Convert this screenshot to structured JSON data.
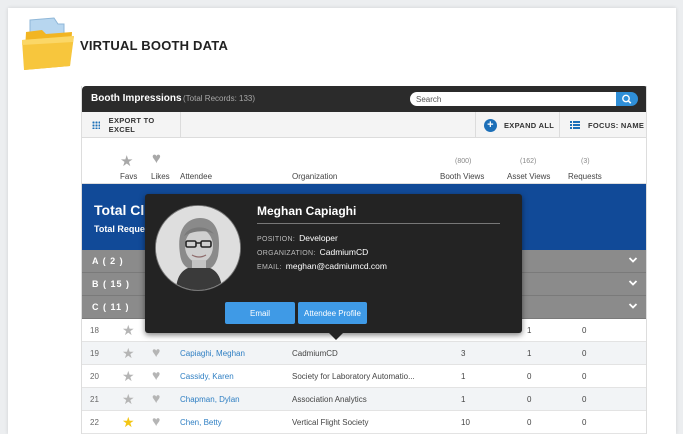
{
  "page": {
    "title": "VIRTUAL BOOTH DATA"
  },
  "panel": {
    "title": "Booth Impressions",
    "records": "(Total Records: 133)",
    "search_placeholder": "Search"
  },
  "toolbar": {
    "export_label": "EXPORT TO EXCEL",
    "expand_label": "EXPAND ALL",
    "focus_label": "FOCUS: NAME"
  },
  "columns": {
    "favs": "Favs",
    "likes": "Likes",
    "attendee": "Attendee",
    "organization": "Organization",
    "booth_views": "Booth Views",
    "booth_views_total": "(800)",
    "asset_views": "Asset Views",
    "asset_views_total": "(162)",
    "requests": "Requests",
    "requests_total": "(3)"
  },
  "totals": {
    "heading": "Total Cli",
    "sub": "Total Reque"
  },
  "groups": [
    {
      "label": "A ( 2 )"
    },
    {
      "label": "B ( 15 )"
    },
    {
      "label": "C ( 11 )"
    }
  ],
  "rows": [
    {
      "num": "18",
      "attendee": "",
      "org": "",
      "booth": "",
      "asset": "1",
      "requests": "0",
      "fav": false
    },
    {
      "num": "19",
      "attendee": "Capiaghi, Meghan",
      "org": "CadmiumCD",
      "booth": "3",
      "asset": "1",
      "requests": "0",
      "fav": false
    },
    {
      "num": "20",
      "attendee": "Cassidy, Karen",
      "org": "Society for Laboratory Automatio...",
      "booth": "1",
      "asset": "0",
      "requests": "0",
      "fav": false
    },
    {
      "num": "21",
      "attendee": "Chapman, Dylan",
      "org": "Association Analytics",
      "booth": "1",
      "asset": "0",
      "requests": "0",
      "fav": false
    },
    {
      "num": "22",
      "attendee": "Chen, Betty",
      "org": "Vertical Flight Society",
      "booth": "10",
      "asset": "0",
      "requests": "0",
      "fav": true
    }
  ],
  "popup": {
    "name": "Meghan Capiaghi",
    "position_key": "POSITION:",
    "position": "Developer",
    "organization_key": "ORGANIZATION:",
    "organization": "CadmiumCD",
    "email_key": "EMAIL:",
    "email": "meghan@cadmiumcd.com",
    "email_button": "Email",
    "profile_button": "Attendee Profile"
  },
  "icons": {
    "folder": "folder-icon",
    "search": "search-icon",
    "export": "grid-icon",
    "expand": "plus-circle-icon",
    "focus": "list-icon",
    "fav": "star-icon",
    "like": "heart-icon",
    "chevron": "chevron-down-icon"
  },
  "colors": {
    "accent": "#2f8fd8",
    "total_band": "#114a98",
    "group_bar": "#8b8b8b",
    "popup_bg": "#232323",
    "fav_star": "#f3c614"
  }
}
